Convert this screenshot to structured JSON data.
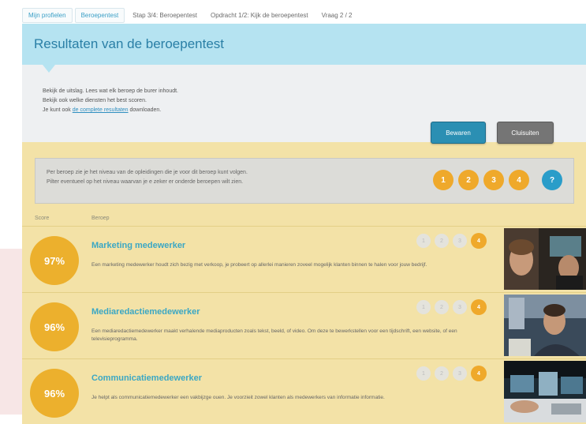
{
  "breadcrumb": [
    {
      "label": "Mijn profielen",
      "style": "link"
    },
    {
      "label": "Beroepentest",
      "style": "link"
    },
    {
      "label": "Stap 3/4: Beroepentest",
      "style": "plain"
    },
    {
      "label": "Opdracht 1/2: Kijk de beroepentest",
      "style": "plain"
    },
    {
      "label": "Vraag 2 / 2",
      "style": "plain"
    }
  ],
  "header": {
    "title": "Resultaten van de beroepentest"
  },
  "intro": {
    "line1": "Bekijk de uitslag. Lees wat elk beroep de burer inhoudt.",
    "line2": "Bekijk ook welke diensten het best scoren.",
    "line3_prefix": "Je kunt ook ",
    "line3_link": "de complete resultaten",
    "line3_suffix": " downloaden."
  },
  "buttons": {
    "save": "Bewaren",
    "close": "Cluisuiten"
  },
  "info": {
    "line1": "Per beroep zie je het niveau van de opleidingen die je voor dit beroep kunt volgen.",
    "line2": "Pilter eventueel op het niveau waarvan je e zeker er onderde beroepen wilt zien.",
    "levels": [
      "1",
      "2",
      "3",
      "4"
    ],
    "help": "?"
  },
  "columns": {
    "score": "Score",
    "beroep": "Beroep"
  },
  "results": [
    {
      "score": "97%",
      "title": "Marketing medewerker",
      "description": "Een marketing medewerker houdt zich bezig met verkoop, je probeert op allerlei manieren zoveel mogelijk klanten binnen te halen voor jouw bedrijf.",
      "levels": [
        "1",
        "2",
        "3",
        "4"
      ],
      "active_level": 4
    },
    {
      "score": "96%",
      "title": "Mediaredactiemedewerker",
      "description": "Een mediaredactiemedewerker maakt verhalende mediaproducten zoals tekst, beeld, of video. Om deze te bewerkstellen voor een tijdschrift, een website, of een televisieprogramma.",
      "levels": [
        "1",
        "2",
        "3",
        "4"
      ],
      "active_level": 4
    },
    {
      "score": "96%",
      "title": "Communicatiemedewerker",
      "description": "Je helpt als communicatiemedewerker een vakbijzge ouen. Je voorzieit zowel klanten als medewerkers van informatie informatie.",
      "levels": [
        "1",
        "2",
        "3",
        "4"
      ],
      "active_level": 4
    }
  ],
  "colors": {
    "header_bg": "#b5e3f1",
    "panel_bg": "#f3e2a7",
    "accent": "#efa92b",
    "title_blue": "#3ba7c4",
    "button_blue": "#2b8fb3"
  }
}
